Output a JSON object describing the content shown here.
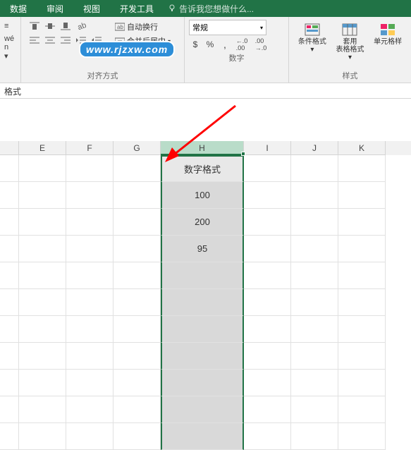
{
  "tabs": {
    "data": "数据",
    "review": "审阅",
    "view": "视图",
    "dev": "开发工具"
  },
  "tellme": "告诉我您想做什么...",
  "align_group": "对齐方式",
  "num_group": "数字",
  "style_group": "样式",
  "sideitems": {
    "top": "≡",
    "mid": "wé",
    "bot": "n ▾"
  },
  "wrap": "自动换行",
  "merge": "合并后居中",
  "num_format": "常规",
  "currency": "$",
  "percent": "%",
  "comma": ",",
  "inc": ".0",
  "dec": ".00",
  "cond_fmt": "条件格式",
  "table_fmt": "套用\n表格格式",
  "cell_fmt": "单元格样",
  "watermark": "www.rjzxw.com",
  "formula": "格式",
  "cols": {
    "E": "E",
    "F": "F",
    "G": "G",
    "H": "H",
    "I": "I",
    "J": "J",
    "K": "K"
  },
  "h_col": {
    "header": "数字格式",
    "rows": [
      "100",
      "200",
      "95",
      "",
      "",
      "",
      "",
      "",
      "",
      ""
    ]
  }
}
